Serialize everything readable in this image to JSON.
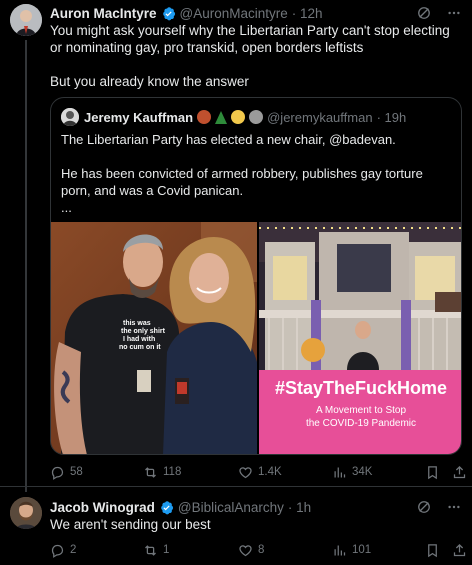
{
  "colors": {
    "background": "#000000",
    "text": "#e7e9ea",
    "muted": "#71767b",
    "verified": "#1d9bf0",
    "pink_banner": "#e74f98"
  },
  "tweet1": {
    "author_name": "Auron MacIntyre",
    "handle": "@AuronMacintyre",
    "time": "· 12h",
    "verified_icon": "verified-badge-icon",
    "text": "You might ask yourself why the Libertarian Party can't stop electing or nominating gay, pro transkid, open borders leftists\n\nBut you already know the answer",
    "quote": {
      "author_name": "Jeremy Kauffman",
      "handle": "@jeremykauffman",
      "time": "· 19h",
      "text": "The Libertarian Party has elected a new chair, @badevan.\n\nHe has been convicted of armed robbery, publishes gay torture porn, and was a Covid panican.\n...",
      "shirt_text": "this was\nthe only shirt\nI had with\nno cum on it",
      "banner_title": "#StayTheFuckHome",
      "banner_subtitle": "A Movement to Stop\nthe COVID-19 Pandemic"
    },
    "actions": {
      "replies": "58",
      "retweets": "118",
      "likes": "1.4K",
      "views": "34K"
    }
  },
  "tweet2": {
    "author_name": "Jacob Winograd",
    "handle": "@BiblicalAnarchy",
    "time": "· 1h",
    "text": "We aren't sending our best",
    "actions": {
      "replies": "2",
      "retweets": "1",
      "likes": "8",
      "views": "101"
    }
  }
}
